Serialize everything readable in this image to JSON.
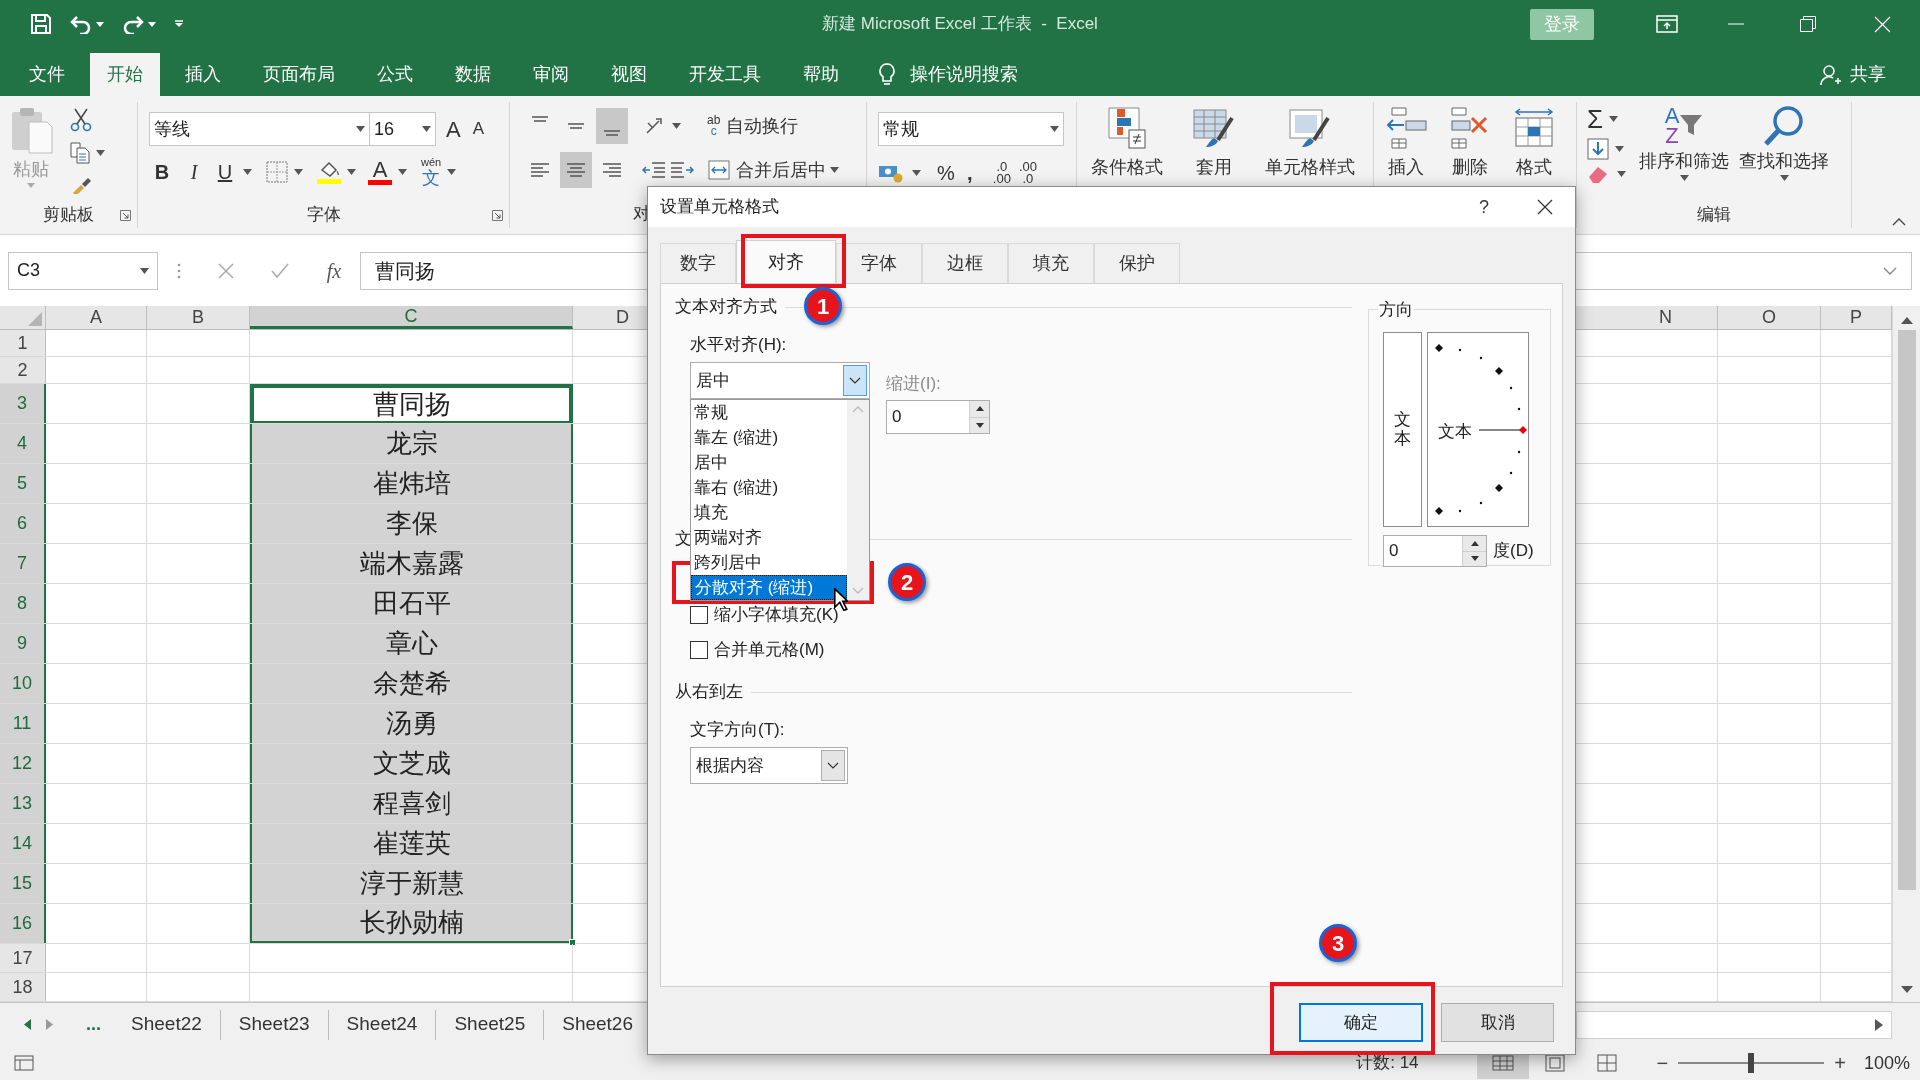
{
  "title_bar": {
    "title": "新建 Microsoft Excel 工作表  -  Excel",
    "sign_in": "登录"
  },
  "ribbon_tabs": [
    {
      "label": "文件",
      "selected": false
    },
    {
      "label": "开始",
      "selected": true
    },
    {
      "label": "插入",
      "selected": false
    },
    {
      "label": "页面布局",
      "selected": false
    },
    {
      "label": "公式",
      "selected": false
    },
    {
      "label": "数据",
      "selected": false
    },
    {
      "label": "审阅",
      "selected": false
    },
    {
      "label": "视图",
      "selected": false
    },
    {
      "label": "开发工具",
      "selected": false
    },
    {
      "label": "帮助",
      "selected": false
    }
  ],
  "tell_me": "操作说明搜索",
  "share": "共享",
  "ribbon": {
    "clipboard": {
      "paste": "粘贴",
      "label": "剪贴板"
    },
    "font": {
      "name": "等线",
      "size": "16",
      "grow": "A",
      "shrink": "A",
      "bold": "B",
      "italic": "I",
      "underline": "U",
      "font_color": "A",
      "phonetic": [
        "wén",
        "文"
      ],
      "label": "字体"
    },
    "alignment": {
      "wrap_icon": [
        "ab",
        "c"
      ],
      "wrap_text": "自动换行",
      "merge_center": "合并后居中",
      "label": "对"
    },
    "number": {
      "format": "常规",
      "percent": "%",
      "comma": ",",
      "decimal_increase": [
        ".0",
        ".00"
      ],
      "decimal_decrease": [
        ".00",
        ".0"
      ]
    },
    "styles": [
      "条件格式",
      "套用",
      "单元格样式"
    ],
    "cells": [
      "插入",
      "删除",
      "格式"
    ],
    "editing": {
      "sum": "Σ",
      "sort_letters": [
        "A",
        "Z"
      ],
      "sort": "排序和筛选",
      "find": "查找和选择",
      "label": "编辑"
    }
  },
  "formula_bar": {
    "name_box": "C3",
    "fx": "fx",
    "content": "曹同扬"
  },
  "sheet": {
    "columns": [
      {
        "label": "A",
        "selected": false
      },
      {
        "label": "B",
        "selected": false
      },
      {
        "label": "C",
        "selected": true
      },
      {
        "label": "D",
        "selected": false
      },
      {
        "label": "N",
        "selected": false
      },
      {
        "label": "O",
        "selected": false
      },
      {
        "label": "P",
        "selected": false
      }
    ],
    "rows": [
      {
        "label": "1",
        "selected": false,
        "active": false
      },
      {
        "label": "2",
        "selected": false,
        "active": false
      },
      {
        "label": "3",
        "selected": true,
        "active": true,
        "value": "曹同扬"
      },
      {
        "label": "4",
        "selected": true,
        "active": false,
        "value": "龙宗"
      },
      {
        "label": "5",
        "selected": true,
        "active": false,
        "value": "崔炜培"
      },
      {
        "label": "6",
        "selected": true,
        "active": false,
        "value": "李保"
      },
      {
        "label": "7",
        "selected": true,
        "active": false,
        "value": "端木嘉露"
      },
      {
        "label": "8",
        "selected": true,
        "active": false,
        "value": "田石平"
      },
      {
        "label": "9",
        "selected": true,
        "active": false,
        "value": "章心"
      },
      {
        "label": "10",
        "selected": true,
        "active": false,
        "value": "余楚希"
      },
      {
        "label": "11",
        "selected": true,
        "active": false,
        "value": "汤勇"
      },
      {
        "label": "12",
        "selected": true,
        "active": false,
        "value": "文芝成"
      },
      {
        "label": "13",
        "selected": true,
        "active": false,
        "value": "程喜剑"
      },
      {
        "label": "14",
        "selected": true,
        "active": false,
        "value": "崔莲英"
      },
      {
        "label": "15",
        "selected": true,
        "active": false,
        "value": "淳于新慧"
      },
      {
        "label": "16",
        "selected": true,
        "active": false,
        "value": "长孙勋楠"
      },
      {
        "label": "17",
        "selected": false,
        "active": false
      },
      {
        "label": "18",
        "selected": false,
        "active": false
      }
    ]
  },
  "sheet_tabs": {
    "more": "...",
    "tabs": [
      "Sheet22",
      "Sheet23",
      "Sheet24",
      "Sheet25",
      "Sheet26"
    ]
  },
  "status_bar": {
    "count": "计数: 14",
    "views": [
      {
        "kind": "normal",
        "selected": true
      },
      {
        "kind": "page_layout",
        "selected": false
      },
      {
        "kind": "page_break",
        "selected": false
      }
    ],
    "zoom_out": "−",
    "zoom_in": "+",
    "zoom": {
      "level": 0.5
    },
    "zoom_text": "100%"
  },
  "dialog": {
    "title": "设置单元格格式",
    "help": "?",
    "tabs": [
      {
        "label": "数字",
        "selected": false
      },
      {
        "label": "对齐",
        "selected": true
      },
      {
        "label": "字体",
        "selected": false
      },
      {
        "label": "边框",
        "selected": false
      },
      {
        "label": "填充",
        "selected": false
      },
      {
        "label": "保护",
        "selected": false
      }
    ],
    "text_alignment": {
      "heading": "文本对齐方式",
      "horizontal_label": "水平对齐(H):",
      "horizontal_value": "居中",
      "options": [
        {
          "label": "常规",
          "selected": false
        },
        {
          "label": "靠左 (缩进)",
          "selected": false
        },
        {
          "label": "居中",
          "selected": false
        },
        {
          "label": "靠右 (缩进)",
          "selected": false
        },
        {
          "label": "填充",
          "selected": false
        },
        {
          "label": "两端对齐",
          "selected": false
        },
        {
          "label": "跨列居中",
          "selected": false
        },
        {
          "label": "分散对齐 (缩进)",
          "selected": true
        }
      ],
      "indent_label": "缩进(I):",
      "indent_disabled": true,
      "indent_value": "0"
    },
    "text_control": {
      "heading": "文",
      "checkboxes": [
        {
          "label": "缩小字体填充(K)",
          "checked": false
        },
        {
          "label": "合并单元格(M)",
          "checked": false
        }
      ]
    },
    "rtl": {
      "heading": "从右到左",
      "direction_label": "文字方向(T):",
      "direction_value": "根据内容"
    },
    "orientation": {
      "heading": "方向",
      "vertical_text": "文本",
      "dial_text": "文本",
      "degrees_value": "0",
      "degrees_label": "度(D)"
    },
    "buttons": [
      {
        "label": "确定",
        "default": true
      },
      {
        "label": "取消",
        "default": false
      }
    ]
  },
  "annotations": [
    {
      "label": "1"
    },
    {
      "label": "2"
    },
    {
      "label": "3"
    }
  ]
}
